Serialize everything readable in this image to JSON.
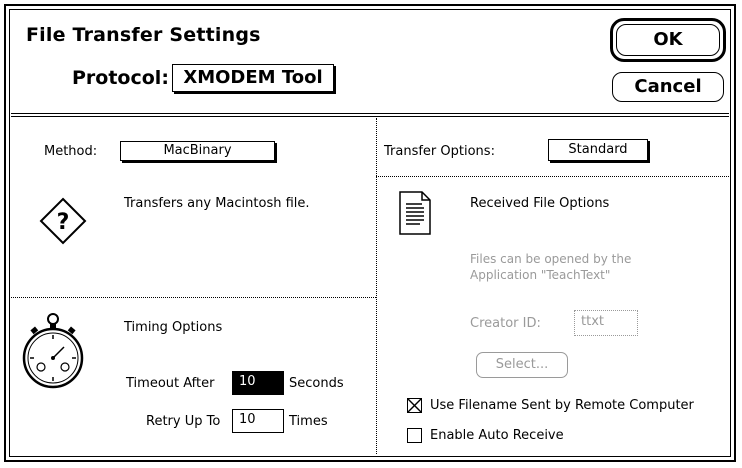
{
  "dialog": {
    "title": "File Transfer Settings",
    "ok_label": "OK",
    "cancel_label": "Cancel"
  },
  "protocol": {
    "label": "Protocol:",
    "value": "XMODEM Tool"
  },
  "method": {
    "label": "Method:",
    "value": "MacBinary",
    "description": "Transfers any Macintosh file.",
    "icon": "question-diamond-icon"
  },
  "timing": {
    "heading": "Timing Options",
    "icon": "stopwatch-icon",
    "timeout_label": "Timeout After",
    "timeout_value": "10",
    "timeout_unit": "Seconds",
    "retry_label": "Retry Up To",
    "retry_value": "10",
    "retry_unit": "Times"
  },
  "transfer_options": {
    "label": "Transfer Options:",
    "value": "Standard"
  },
  "received_file_options": {
    "heading": "Received File Options",
    "icon": "document-icon",
    "note_line1": "Files can be opened by the",
    "note_line2": "Application \"TeachText\"",
    "creator_label": "Creator ID:",
    "creator_value": "ttxt",
    "select_label": "Select..."
  },
  "checkboxes": {
    "use_filename_label": "Use Filename Sent by Remote Computer",
    "use_filename_checked": true,
    "auto_receive_label": "Enable Auto Receive",
    "auto_receive_checked": false
  }
}
